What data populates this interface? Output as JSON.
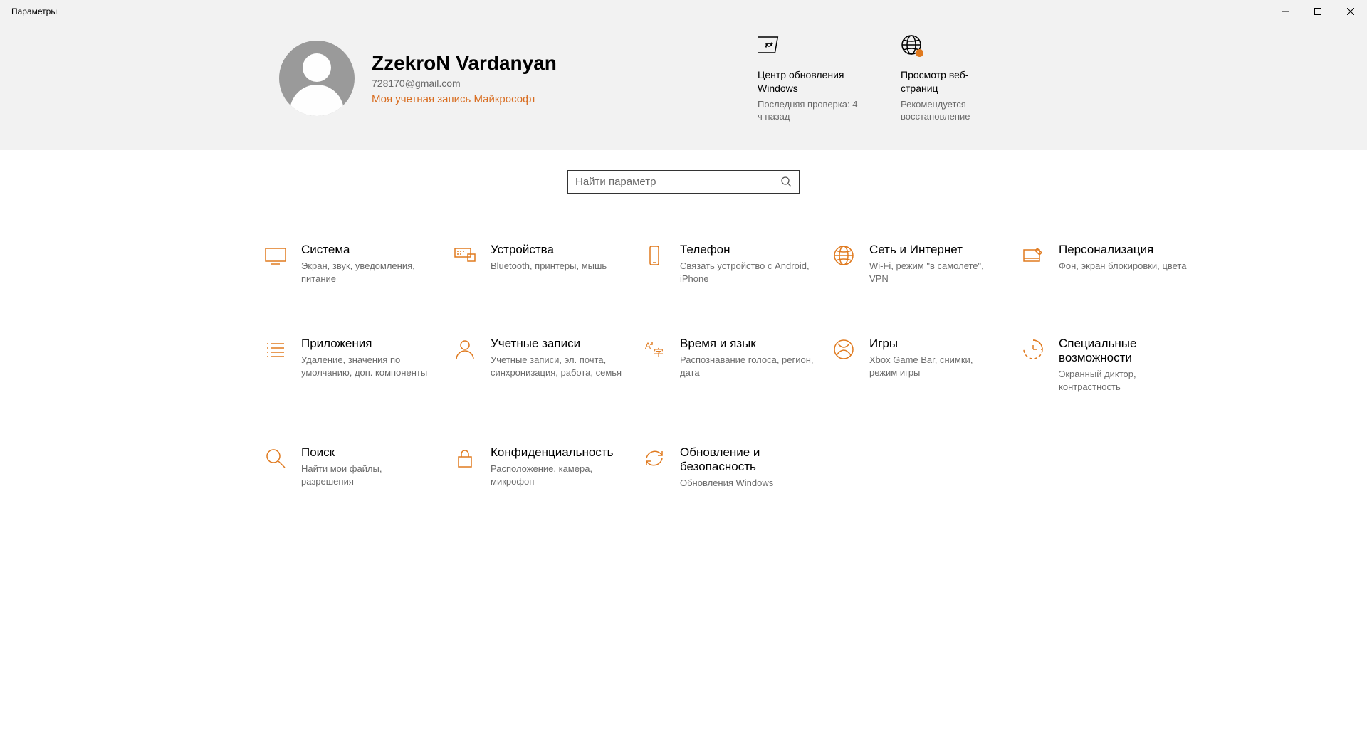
{
  "window": {
    "title": "Параметры"
  },
  "user": {
    "name": "ZzekroN Vardanyan",
    "email": "728170@gmail.com",
    "account_link": "Моя учетная запись Майкрософт"
  },
  "status_tiles": [
    {
      "title": "Центр обновления Windows",
      "subtitle": "Последняя проверка: 4 ч назад"
    },
    {
      "title": "Просмотр веб-страниц",
      "subtitle": "Рекомендуется восстановление"
    }
  ],
  "search": {
    "placeholder": "Найти параметр"
  },
  "categories": [
    {
      "title": "Система",
      "desc": "Экран, звук, уведомления, питание"
    },
    {
      "title": "Устройства",
      "desc": "Bluetooth, принтеры, мышь"
    },
    {
      "title": "Телефон",
      "desc": "Связать устройство с Android, iPhone"
    },
    {
      "title": "Сеть и Интернет",
      "desc": "Wi-Fi, режим \"в самолете\", VPN"
    },
    {
      "title": "Персонализация",
      "desc": "Фон, экран блокировки, цвета"
    },
    {
      "title": "Приложения",
      "desc": "Удаление, значения по умолчанию, доп. компоненты"
    },
    {
      "title": "Учетные записи",
      "desc": "Учетные записи, эл. почта, синхронизация, работа, семья"
    },
    {
      "title": "Время и язык",
      "desc": "Распознавание голоса, регион, дата"
    },
    {
      "title": "Игры",
      "desc": "Xbox Game Bar, снимки, режим игры"
    },
    {
      "title": "Специальные возможности",
      "desc": "Экранный диктор, контрастность"
    },
    {
      "title": "Поиск",
      "desc": "Найти мои файлы, разрешения"
    },
    {
      "title": "Конфиденциальность",
      "desc": "Расположение, камера, микрофон"
    },
    {
      "title": "Обновление и безопасность",
      "desc": "Обновления Windows"
    }
  ]
}
